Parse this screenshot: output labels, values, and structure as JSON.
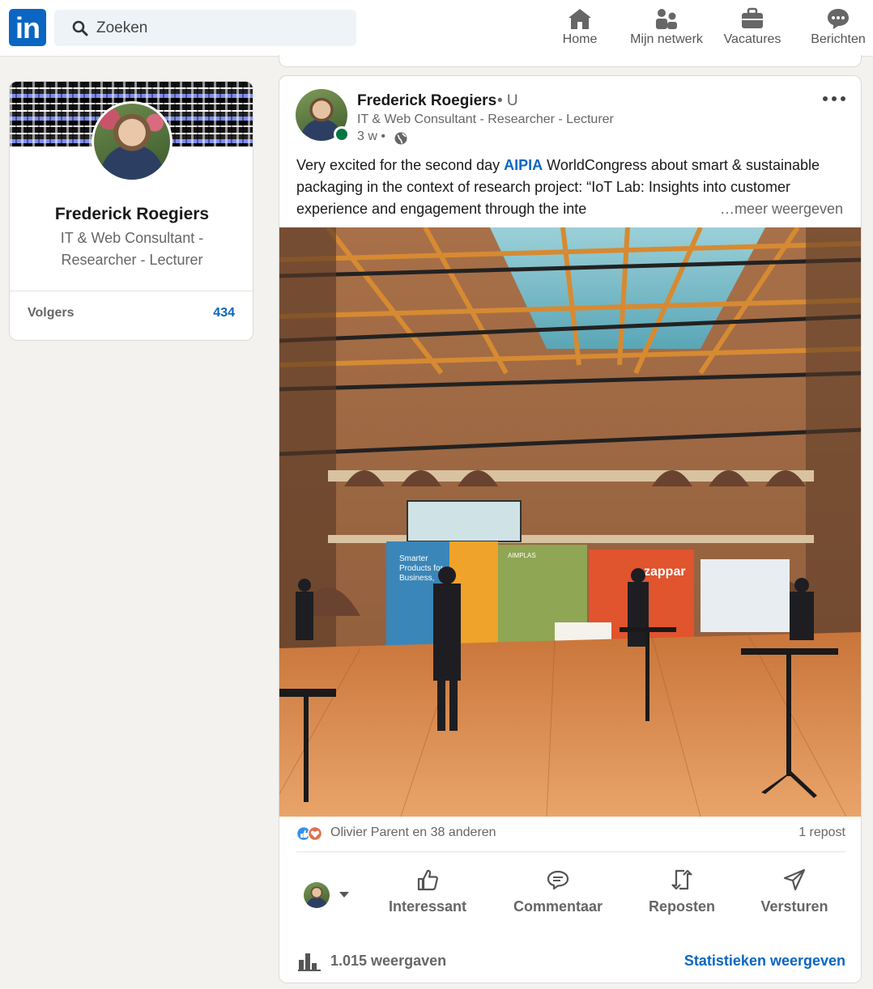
{
  "nav": {
    "logo_text": "in",
    "search_placeholder": "Zoeken",
    "items": [
      {
        "label": "Home",
        "icon": "home-icon"
      },
      {
        "label": "Mijn netwerk",
        "icon": "network-icon"
      },
      {
        "label": "Vacatures",
        "icon": "briefcase-icon"
      },
      {
        "label": "Berichten",
        "icon": "messaging-icon"
      }
    ]
  },
  "profile": {
    "name": "Frederick Roegiers",
    "headline": "IT & Web Consultant - Researcher - Lecturer",
    "followers_label": "Volgers",
    "followers_count": "434"
  },
  "post": {
    "author": "Frederick Roegiers",
    "degree": "• U",
    "headline": "IT & Web Consultant - Researcher - Lecturer",
    "time": "3 w •",
    "text_before": "Very excited for the second day ",
    "text_highlight": "AIPIA",
    "text_after": " WorldCongress about smart & sustainable packaging in the context of research project: “IoT Lab: Insights into customer experience and engagement through the inte",
    "see_more": "…meer weergeven",
    "image_texts": {
      "stand_left": "Smarter Products for Business, People, and Planet",
      "stand_center": "AIMPLAS",
      "stand_right": "zappar"
    },
    "reactions_text": "Olivier Parent en 38 anderen",
    "reposts": "1 repost",
    "actions": [
      "Interessant",
      "Commentaar",
      "Reposten",
      "Versturen"
    ],
    "views": "1.015 weergaven",
    "stats_link": "Statistieken weergeven"
  },
  "colors": {
    "brand": "#0a66c2",
    "background": "#f3f2ef",
    "online": "#057642"
  }
}
